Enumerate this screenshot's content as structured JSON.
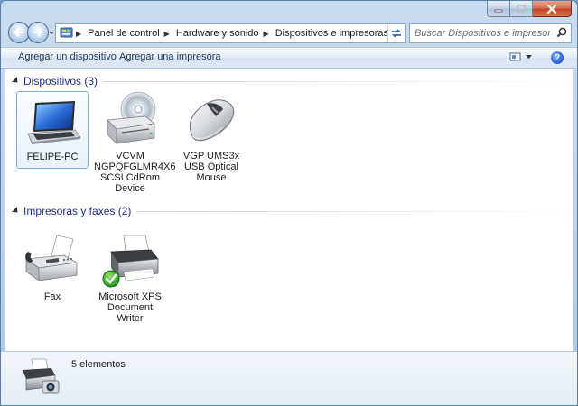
{
  "navigation": {
    "breadcrumb": [
      "Panel de control",
      "Hardware y sonido",
      "Dispositivos e impresoras"
    ],
    "search_placeholder": "Buscar Dispositivos e impresoras"
  },
  "toolbar": {
    "add_device_label": "Agregar un dispositivo",
    "add_printer_label": "Agregar una impresora",
    "help_label": "?"
  },
  "groups": {
    "devices": {
      "title": "Dispositivos (3)",
      "items": [
        {
          "label": "FELIPE-PC",
          "icon": "laptop-icon",
          "selected": true
        },
        {
          "label": "VCVM NGPQFGLMR4X6 SCSI CdRom Device",
          "icon": "cdrom-drive-icon",
          "selected": false
        },
        {
          "label": "VGP UMS3x USB Optical Mouse",
          "icon": "mouse-icon",
          "selected": false
        }
      ]
    },
    "printers": {
      "title": "Impresoras y faxes (2)",
      "items": [
        {
          "label": "Fax",
          "icon": "fax-icon",
          "selected": false
        },
        {
          "label": "Microsoft XPS Document Writer",
          "icon": "printer-default-icon",
          "selected": false
        }
      ]
    }
  },
  "details": {
    "count_text": "5 elementos"
  },
  "colors": {
    "group_title": "#1e3287",
    "command_text": "#1e395b",
    "window_frame": "#b9d0e8"
  }
}
